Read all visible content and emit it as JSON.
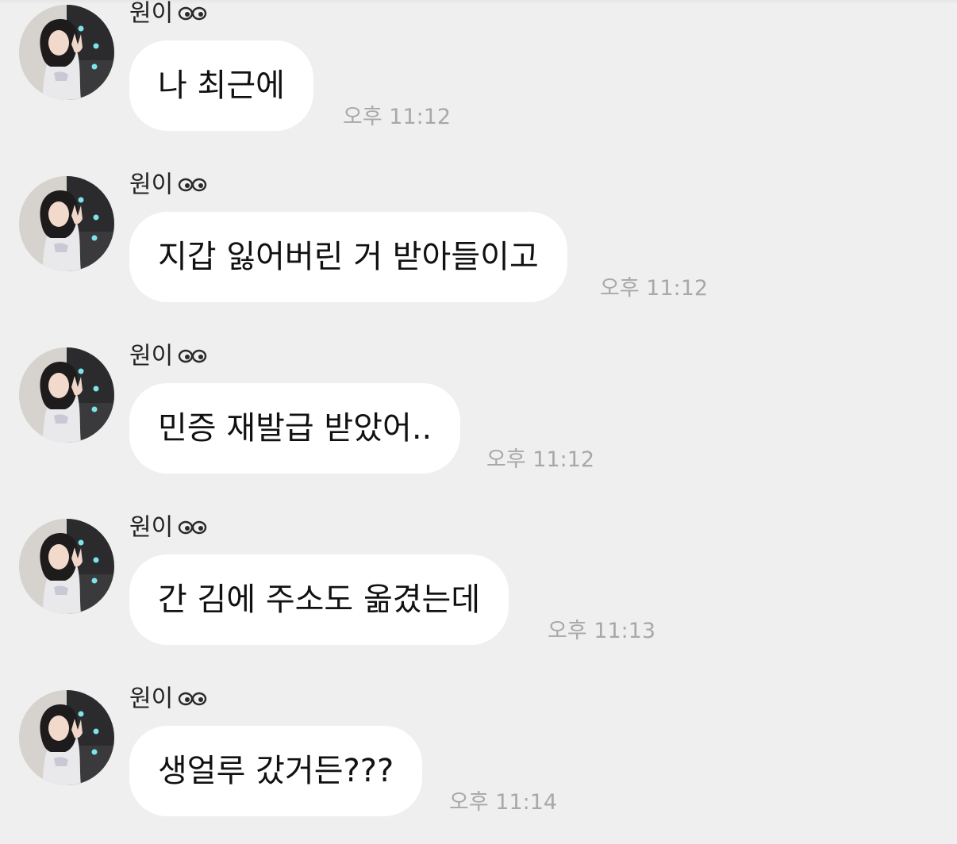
{
  "chat": {
    "messages": [
      {
        "sender": "원이",
        "text": "나 최근에",
        "time": "오후 11:12"
      },
      {
        "sender": "원이",
        "text": "지갑 잃어버린 거 받아들이고",
        "time": "오후 11:12"
      },
      {
        "sender": "원이",
        "text": "민증 재발급 받았어..",
        "time": "오후 11:12"
      },
      {
        "sender": "원이",
        "text": "간 김에 주소도 옮겼는데",
        "time": "오후 11:13"
      },
      {
        "sender": "원이",
        "text": "생얼루 갔거든???",
        "time": "오후 11:14"
      }
    ]
  },
  "icons": {
    "sender_badge": "eyes-icon",
    "avatar": "profile-photo"
  },
  "colors": {
    "background": "#efefef",
    "bubble": "#ffffff",
    "text": "#111111",
    "timestamp": "#a8a8a8"
  }
}
